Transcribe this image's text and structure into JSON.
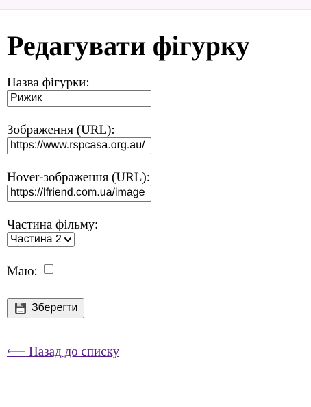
{
  "page": {
    "title": "Редагувати фігурку"
  },
  "form": {
    "name": {
      "label": "Назва фігурки:",
      "value": "Рижик"
    },
    "image_url": {
      "label": "Зображення (URL):",
      "value": "https://www.rspcasa.org.au/"
    },
    "hover_image_url": {
      "label": "Hover-зображення (URL):",
      "value": "https://lfriend.com.ua/image"
    },
    "film_part": {
      "label": "Частина фільму:",
      "selected": "Частина 2"
    },
    "owned": {
      "label": "Маю:",
      "checked": false
    },
    "save_button": {
      "label": "Зберегти",
      "icon": "floppy-disk-icon"
    }
  },
  "back_link": {
    "arrow": "⟵",
    "label": "Назад до списку"
  },
  "colors": {
    "link_visited": "#551a8b",
    "button_bg": "#efefef",
    "border": "#767676"
  }
}
